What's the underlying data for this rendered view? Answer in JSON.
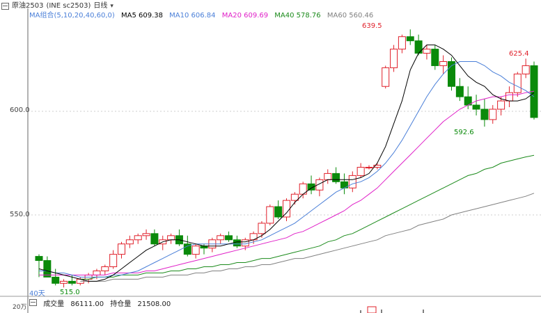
{
  "header": {
    "symbol": "原油2503",
    "exchange_code": "(INE sc2503)",
    "period": "日线",
    "menu_icon": "window-icon",
    "dropdown_icon": "chevron-down-icon"
  },
  "ma_legend": {
    "group": "MA组合(5,10,20,40,60,0)",
    "ma5": "MA5 609.38",
    "ma10": "MA10 606.84",
    "ma20": "MA20 609.69",
    "ma40": "MA40 578.76",
    "ma60": "MA60 560.46",
    "colors": {
      "ma5": "#000000",
      "ma10": "#4a7fd8",
      "ma20": "#e020c8",
      "ma40": "#1a8a1a",
      "ma60": "#808080"
    }
  },
  "y_axis": {
    "labels": [
      "600.0",
      "550.0"
    ],
    "volume_label": "20万"
  },
  "annotations": {
    "high": "639.5",
    "recent_high": "625.4",
    "recent_low": "592.6",
    "low": "515.0",
    "days": "40天"
  },
  "volume_panel": {
    "label": "成交量",
    "volume": "86111.00",
    "oi_label": "持仓量",
    "oi": "21508.00"
  },
  "chart_data": {
    "type": "candlestick",
    "ylim": [
      507,
      652
    ],
    "up_color": "#e0202a",
    "down_color": "#0a8a0a",
    "candles": [
      [
        530,
        531,
        520,
        528
      ],
      [
        528,
        530,
        523,
        520
      ],
      [
        520,
        524,
        516,
        517
      ],
      [
        517,
        519,
        515,
        518
      ],
      [
        518,
        521,
        516,
        517
      ],
      [
        517,
        520,
        516,
        519
      ],
      [
        519,
        522,
        517,
        521
      ],
      [
        521,
        524,
        519,
        523
      ],
      [
        523,
        526,
        521,
        525
      ],
      [
        525,
        533,
        524,
        531
      ],
      [
        531,
        537,
        529,
        536
      ],
      [
        536,
        540,
        534,
        538
      ],
      [
        538,
        541,
        536,
        540
      ],
      [
        540,
        543,
        538,
        541
      ],
      [
        541,
        543,
        535,
        536
      ],
      [
        536,
        540,
        533,
        538
      ],
      [
        538,
        541,
        536,
        540
      ],
      [
        540,
        543,
        535,
        536
      ],
      [
        536,
        540,
        530,
        531
      ],
      [
        531,
        536,
        529,
        535
      ],
      [
        535,
        536,
        531,
        534
      ],
      [
        534,
        539,
        532,
        538
      ],
      [
        538,
        541,
        536,
        540
      ],
      [
        540,
        542,
        537,
        538
      ],
      [
        538,
        540,
        534,
        535
      ],
      [
        535,
        539,
        533,
        538
      ],
      [
        538,
        542,
        536,
        541
      ],
      [
        541,
        547,
        539,
        546
      ],
      [
        546,
        555,
        545,
        554
      ],
      [
        554,
        557,
        548,
        549
      ],
      [
        549,
        558,
        547,
        557
      ],
      [
        557,
        561,
        555,
        560
      ],
      [
        560,
        566,
        558,
        565
      ],
      [
        565,
        569,
        560,
        562
      ],
      [
        562,
        568,
        559,
        567
      ],
      [
        567,
        572,
        565,
        570
      ],
      [
        570,
        573,
        565,
        566
      ],
      [
        566,
        570,
        560,
        563
      ],
      [
        563,
        571,
        561,
        569
      ],
      [
        569,
        575,
        568,
        573
      ],
      [
        573,
        574,
        572,
        573
      ],
      [
        573,
        575,
        572,
        574
      ],
      [
        612,
        622,
        611,
        621
      ],
      [
        621,
        632,
        619,
        630
      ],
      [
        630,
        637,
        628,
        636
      ],
      [
        636,
        639.5,
        632,
        634
      ],
      [
        634,
        637,
        627,
        628
      ],
      [
        628,
        632,
        625,
        630
      ],
      [
        630,
        632,
        620,
        622
      ],
      [
        622,
        627,
        618,
        624
      ],
      [
        624,
        626,
        610,
        612
      ],
      [
        612,
        616,
        605,
        607
      ],
      [
        607,
        612,
        601,
        603
      ],
      [
        603,
        608,
        598,
        601
      ],
      [
        601,
        606,
        592.6,
        596
      ],
      [
        596,
        603,
        594,
        601
      ],
      [
        601,
        607,
        598,
        605
      ],
      [
        605,
        612,
        602,
        609
      ],
      [
        609,
        619,
        607,
        618
      ],
      [
        618,
        625.4,
        616,
        622
      ],
      [
        622,
        624,
        596,
        597
      ]
    ],
    "ma5": [
      524,
      523,
      522,
      521,
      520,
      519,
      518,
      518,
      519,
      521,
      524,
      527,
      530,
      533,
      535,
      537,
      538,
      538,
      537,
      536,
      535,
      535,
      535,
      536,
      537,
      537,
      538,
      540,
      543,
      547,
      551,
      556,
      560,
      563,
      565,
      567,
      567,
      567,
      567,
      568,
      570,
      575,
      583,
      594,
      605,
      620,
      628,
      632,
      632,
      630,
      627,
      622,
      617,
      614,
      612,
      608,
      606,
      605,
      605,
      606,
      609
    ],
    "ma10": [
      523,
      523,
      522,
      522,
      521,
      520,
      520,
      520,
      520,
      521,
      521,
      522,
      523,
      525,
      527,
      529,
      531,
      533,
      535,
      536,
      536,
      536,
      536,
      536,
      536,
      536,
      537,
      538,
      540,
      542,
      544,
      546,
      549,
      552,
      555,
      558,
      561,
      563,
      565,
      566,
      568,
      571,
      575,
      580,
      586,
      593,
      600,
      607,
      613,
      618,
      622,
      624,
      624,
      624,
      622,
      619,
      617,
      614,
      612,
      610,
      607
    ],
    "ma20": [
      521,
      521,
      521,
      521,
      521,
      521,
      521,
      521,
      521,
      522,
      522,
      522,
      522,
      523,
      523,
      524,
      525,
      526,
      527,
      528,
      529,
      530,
      531,
      532,
      533,
      534,
      535,
      536,
      537,
      538,
      539,
      541,
      542,
      544,
      546,
      548,
      550,
      552,
      555,
      557,
      560,
      563,
      567,
      571,
      575,
      579,
      583,
      587,
      591,
      595,
      598,
      601,
      603,
      605,
      606,
      607,
      607,
      608,
      608,
      609,
      609.69
    ],
    "ma40": [
      519,
      519,
      520,
      520,
      520,
      521,
      521,
      521,
      522,
      522,
      522,
      523,
      523,
      524,
      524,
      525,
      525,
      526,
      526,
      527,
      527,
      528,
      529,
      529,
      530,
      531,
      532,
      533,
      534,
      535,
      537,
      538,
      540,
      541,
      543,
      545,
      547,
      549,
      551,
      553,
      555,
      557,
      559,
      561,
      563,
      565,
      567,
      569,
      570,
      572,
      573,
      575,
      576,
      577,
      578,
      578.76
    ],
    "ma60": [
      518,
      518,
      518,
      518,
      519,
      519,
      519,
      519,
      520,
      520,
      520,
      521,
      521,
      521,
      522,
      522,
      523,
      523,
      524,
      524,
      525,
      525,
      526,
      526,
      527,
      528,
      529,
      529,
      530,
      531,
      532,
      533,
      534,
      535,
      536,
      537,
      538,
      540,
      541,
      542,
      543,
      545,
      546,
      547,
      548,
      550,
      551,
      552,
      553,
      554,
      555,
      556,
      557,
      558,
      559,
      560.46
    ]
  }
}
